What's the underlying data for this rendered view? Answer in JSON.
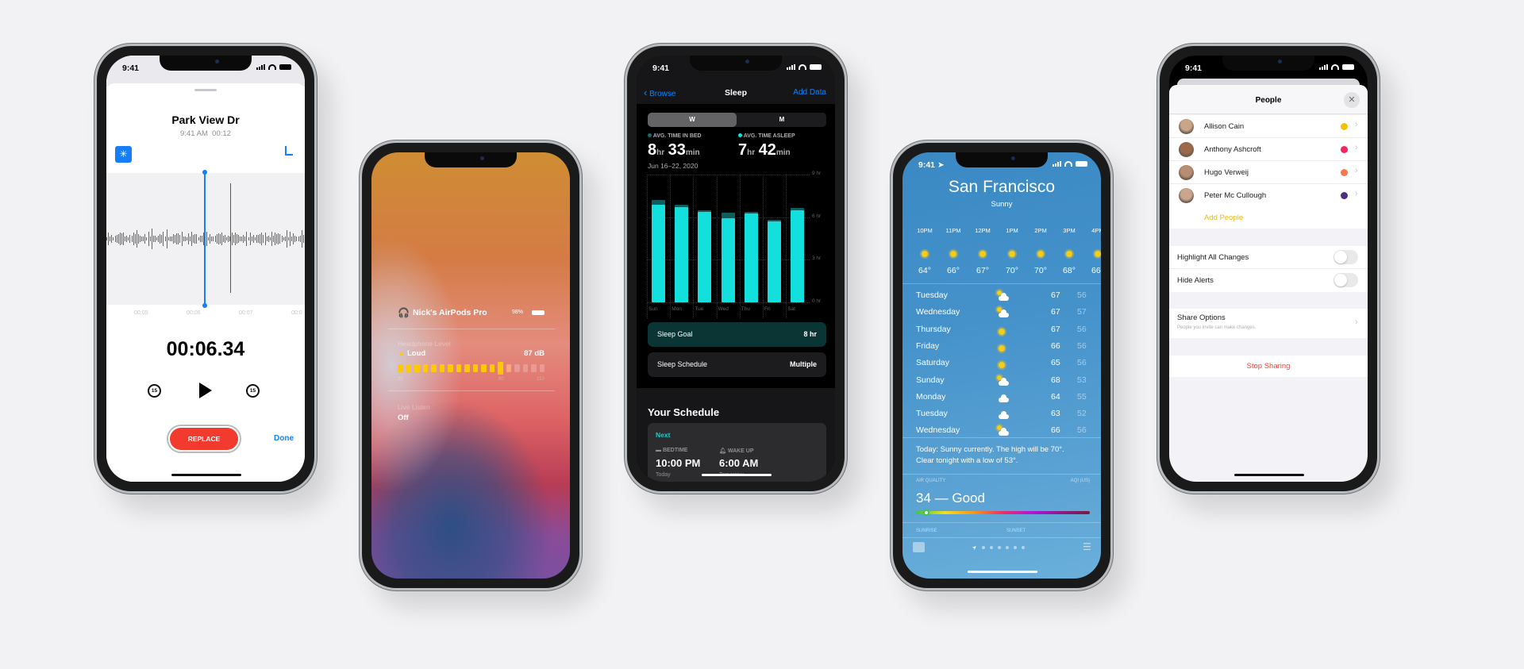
{
  "status_time": "9:41",
  "voice_memo": {
    "title": "Park View Dr",
    "subtitle": "9:41 AM  00:12",
    "timeline_labels": [
      "00:05",
      "00:06",
      "00:07",
      "00:0"
    ],
    "elapsed": "00:06.34",
    "skip_back_label": "15",
    "skip_forward_label": "15",
    "replace_label": "REPLACE",
    "done_label": "Done",
    "accent": "#147efb",
    "replace_color": "#f23a2f"
  },
  "airpods": {
    "device_name": "Nick's AirPods Pro",
    "battery": "98%",
    "level_label": "Headphone Level",
    "level_status": "Loud",
    "level_value": "87 dB",
    "meter": {
      "total_segments": 18,
      "active_segments": 13
    },
    "scale_labels": [
      "20",
      "80",
      "110"
    ],
    "live_listen_label": "Live Listen",
    "live_listen_value": "Off"
  },
  "sleep": {
    "back_label": "Browse",
    "title": "Sleep",
    "add_label": "Add Data",
    "segments": [
      "W",
      "M"
    ],
    "selected_segment": "W",
    "bed_label": "AVG. TIME IN BED",
    "bed_hr": "8",
    "bed_min": "33",
    "asleep_label": "AVG. TIME ASLEEP",
    "asleep_hr": "7",
    "asleep_min": "42",
    "hr_unit": "hr",
    "min_unit": "min",
    "date_range": "Jun 16–22, 2020",
    "chart": {
      "type": "bar",
      "categories": [
        "Sun",
        "Mon",
        "Tue",
        "Wed",
        "Thu",
        "Fri",
        "Sat"
      ],
      "y_ticks": [
        "9 hr",
        "6 hr",
        "3 hr",
        "0 hr"
      ],
      "ylim": [
        0,
        9
      ],
      "series": [
        {
          "name": "AVG. TIME IN BED",
          "values": [
            7.2,
            6.9,
            6.5,
            6.3,
            6.4,
            5.8,
            6.65
          ],
          "color": "#0e5e5e"
        },
        {
          "name": "AVG. TIME ASLEEP",
          "values": [
            6.9,
            6.7,
            6.35,
            5.9,
            6.25,
            5.7,
            6.5
          ],
          "color": "#13e0dc"
        }
      ]
    },
    "goal_label": "Sleep Goal",
    "goal_value": "8 hr",
    "schedule_label": "Sleep Schedule",
    "schedule_value": "Multiple",
    "your_schedule": "Your Schedule",
    "next_label": "Next",
    "bedtime_label": "BEDTIME",
    "bedtime": "10:00 PM",
    "bedtime_day": "Today",
    "wake_label": "WAKE UP",
    "wake": "6:00 AM",
    "wake_day": "Tomorrow"
  },
  "weather": {
    "city": "San Francisco",
    "condition": "Sunny",
    "hourly": [
      {
        "time": "10PM",
        "temp": "64°",
        "icon": "sun-icon"
      },
      {
        "time": "11PM",
        "temp": "66°",
        "icon": "sun-icon"
      },
      {
        "time": "12PM",
        "temp": "67°",
        "icon": "sun-icon"
      },
      {
        "time": "1PM",
        "temp": "70°",
        "icon": "sun-icon"
      },
      {
        "time": "2PM",
        "temp": "70°",
        "icon": "sun-icon"
      },
      {
        "time": "3PM",
        "temp": "68°",
        "icon": "sun-icon"
      },
      {
        "time": "4PM",
        "temp": "66°",
        "icon": "sun-icon"
      }
    ],
    "daily": [
      {
        "day": "Tuesday",
        "icon": "partly-cloudy-icon",
        "high": "67",
        "low": "56"
      },
      {
        "day": "Wednesday",
        "icon": "partly-cloudy-icon",
        "high": "67",
        "low": "57"
      },
      {
        "day": "Thursday",
        "icon": "sun-icon",
        "high": "67",
        "low": "56"
      },
      {
        "day": "Friday",
        "icon": "sun-icon",
        "high": "66",
        "low": "56"
      },
      {
        "day": "Saturday",
        "icon": "sun-icon",
        "high": "65",
        "low": "56"
      },
      {
        "day": "Sunday",
        "icon": "partly-cloudy-icon",
        "high": "68",
        "low": "53"
      },
      {
        "day": "Monday",
        "icon": "cloud-icon",
        "high": "64",
        "low": "55"
      },
      {
        "day": "Tuesday",
        "icon": "cloud-icon",
        "high": "63",
        "low": "52"
      },
      {
        "day": "Wednesday",
        "icon": "partly-cloudy-icon",
        "high": "66",
        "low": "56"
      }
    ],
    "summary": "Today: Sunny currently. The high will be 70°. Clear tonight with a low of 53°.",
    "aq_label": "AIR QUALITY",
    "aq_scale": "AQI (US)",
    "aq_value": "34 — Good",
    "aq_fraction": 0.06,
    "sunrise_label": "SUNRISE",
    "sunset_label": "SUNSET",
    "page_dots": 6
  },
  "people": {
    "title": "People",
    "members": [
      {
        "name": "Allison Cain",
        "color": "#f2c200"
      },
      {
        "name": "Anthony Ashcroft",
        "color": "#f5245a"
      },
      {
        "name": "Hugo Verweij",
        "color": "#f6794a"
      },
      {
        "name": "Peter Mc Cullough",
        "color": "#4f2d7f"
      }
    ],
    "add_label": "Add People",
    "highlight_label": "Highlight All Changes",
    "highlight_on": false,
    "hide_alerts_label": "Hide Alerts",
    "hide_alerts_on": false,
    "share_label": "Share Options",
    "share_sub": "People you invite can make changes.",
    "stop_label": "Stop Sharing"
  }
}
